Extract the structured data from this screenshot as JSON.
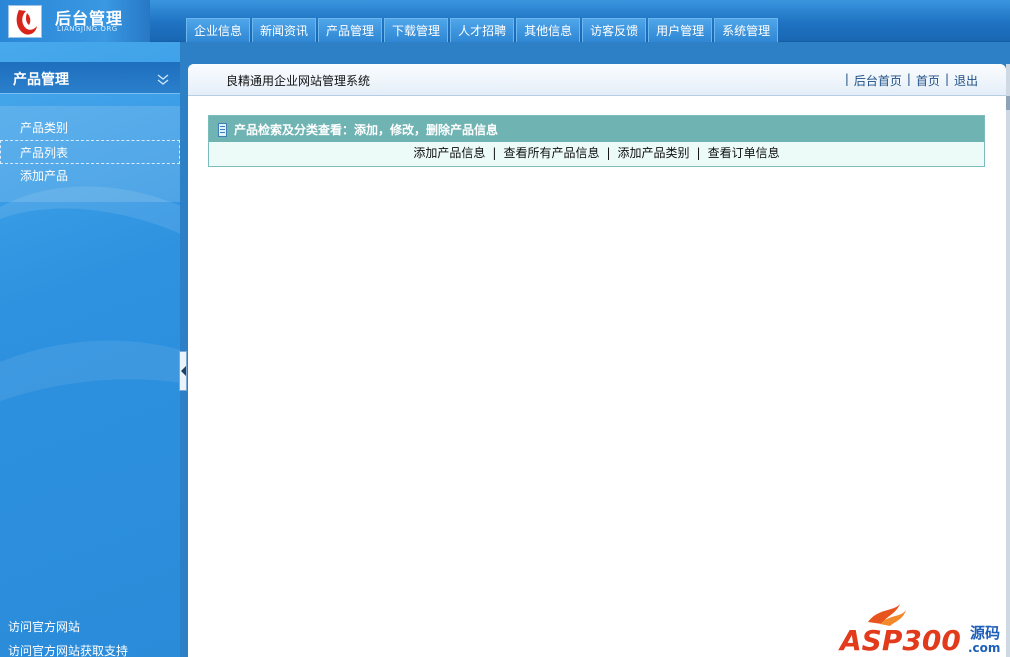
{
  "logo": {
    "title": "后台管理",
    "subtitle": "LIANGJING.ORG"
  },
  "nav": {
    "tabs": [
      "企业信息",
      "新闻资讯",
      "产品管理",
      "下载管理",
      "人才招聘",
      "其他信息",
      "访客反馈",
      "用户管理",
      "系统管理"
    ]
  },
  "sidebar": {
    "title": "产品管理",
    "items": [
      "产品类别",
      "产品列表",
      "添加产品"
    ],
    "active_index": 1,
    "footer_links": [
      "访问官方网站",
      "访问官方网站获取支持"
    ]
  },
  "main": {
    "system_name": "良精通用企业网站管理系统",
    "header_links": [
      "后台首页",
      "首页",
      "退出"
    ],
    "panel": {
      "title": "产品检索及分类查看：添加，修改，删除产品信息",
      "links": [
        "添加产品信息",
        "查看所有产品信息",
        "添加产品类别",
        "查看订单信息"
      ]
    }
  },
  "watermark": {
    "brand": "ASP300",
    "suffix": "源码",
    "domain": ".com"
  },
  "colors": {
    "sidebar_blue": "#2e92e0",
    "panel_header_teal": "#6fb3b2",
    "panel_body_mint": "#ecfbf8"
  }
}
